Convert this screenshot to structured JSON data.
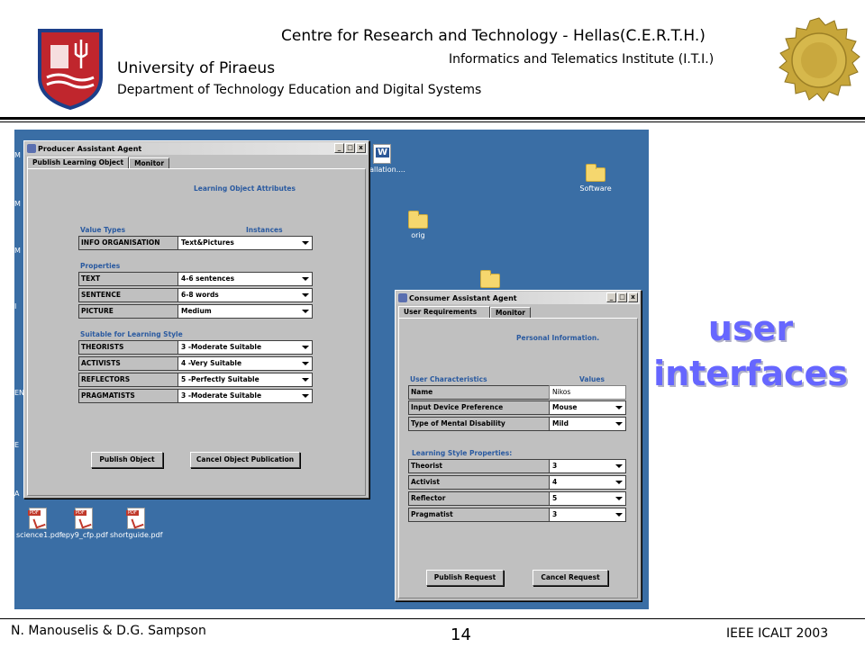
{
  "header": {
    "title": "Centre for Research and Technology - Hellas(C.E.R.T.H.)",
    "institute": "Informatics and Telematics Institute (I.T.I.)",
    "university": "University of Piraeus",
    "department": "Department of Technology Education and Digital Systems",
    "left_logo_icon": "university-crest-icon",
    "right_logo_icon": "gold-seal-icon"
  },
  "desktop": {
    "background_color": "#3a6ea5",
    "icons": {
      "word_doc": "allation....",
      "software": "Software",
      "orig": "orig",
      "pdf1": "science1.pdf",
      "pdf2": "epy9_cfp.pdf",
      "pdf3": "shortguide.pdf"
    },
    "left_stubs": [
      "M",
      "M",
      "M",
      "I",
      "EN",
      "E",
      "A"
    ]
  },
  "producer": {
    "title": "Producer Assistant Agent",
    "tabs": [
      "Publish Learning Object",
      "Monitor"
    ],
    "section_title": "Learning Object Attributes",
    "col_value_types": "Value Types",
    "col_instances": "Instances",
    "info_row": {
      "name": "INFO ORGANISATION",
      "value": "Text&Pictures"
    },
    "properties_label": "Properties",
    "properties": [
      {
        "name": "TEXT",
        "value": "4-6 sentences"
      },
      {
        "name": "SENTENCE",
        "value": "6-8 words"
      },
      {
        "name": "PICTURE",
        "value": "Medium"
      }
    ],
    "style_label": "Suitable for Learning Style",
    "styles": [
      {
        "name": "THEORISTS",
        "value": "3 -Moderate  Suitable"
      },
      {
        "name": "ACTIVISTS",
        "value": "4 -Very Suitable"
      },
      {
        "name": "REFLECTORS",
        "value": "5 -Perfectly Suitable"
      },
      {
        "name": "PRAGMATISTS",
        "value": "3 -Moderate  Suitable"
      }
    ],
    "publish_button": "Publish Object",
    "cancel_button": "Cancel Object Publication"
  },
  "consumer": {
    "title": "Consumer Assistant Agent",
    "tabs": [
      "User Requirements",
      "Monitor"
    ],
    "section_title": "Personal Information.",
    "col_characteristics": "User Characteristics",
    "col_values": "Values",
    "name_row": {
      "name": "Name",
      "value": "Nikos"
    },
    "characteristics": [
      {
        "name": "Input Device Preference",
        "value": "Mouse"
      },
      {
        "name": "Type of Mental Disability",
        "value": "Mild"
      }
    ],
    "style_label": "Learning Style Properties:",
    "styles": [
      {
        "name": "Theorist",
        "value": "3"
      },
      {
        "name": "Activist",
        "value": "4"
      },
      {
        "name": "Reflector",
        "value": "5"
      },
      {
        "name": "Pragmatist",
        "value": "3"
      }
    ],
    "publish_button": "Publish Request",
    "cancel_button": "Cancel Request"
  },
  "window_buttons": {
    "minimize": "_",
    "maximize": "□",
    "close": "x"
  },
  "big_label": {
    "line1": "user",
    "line2": "interfaces",
    "color": "#6666ff"
  },
  "footer": {
    "authors": "N. Manouselis & D.G. Sampson",
    "page_number": "14",
    "conference": "IEEE ICALT 2003"
  }
}
